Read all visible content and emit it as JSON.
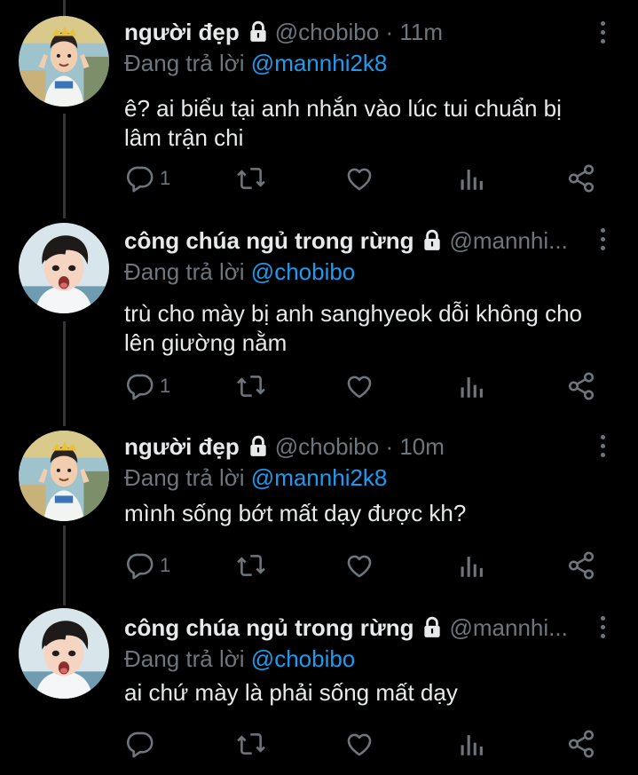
{
  "tweets": [
    {
      "name": "người đẹp",
      "handle": "@chobibo",
      "time": "11m",
      "replying_prefix": "Đang trả lời",
      "replying_to": "@mannhi2k8",
      "text": "ê? ai biểu tại anh nhắn vào lúc tui chuẩn bị lâm trận chi",
      "reply_count": "1",
      "avatar": "boy-with-crown"
    },
    {
      "name": "công chúa ngủ trong rừng",
      "handle": "@mannhi...",
      "replying_prefix": "Đang trả lời",
      "replying_to": "@chobibo",
      "text": "trù cho mày bị anh sanghyeok dỗi không cho lên giường nằm",
      "reply_count": "1",
      "avatar": "surprised-boy"
    },
    {
      "name": "người đẹp",
      "handle": "@chobibo",
      "time": "10m",
      "replying_prefix": "Đang trả lời",
      "replying_to": "@mannhi2k8",
      "text": "mình sống bớt mất dạy được kh?",
      "reply_count": "1",
      "avatar": "boy-with-crown"
    },
    {
      "name": "công chúa ngủ trong rừng",
      "handle": "@mannhi...",
      "replying_prefix": "Đang trả lời",
      "replying_to": "@chobibo",
      "text": "ai chứ mày là phải sống mất dạy",
      "reply_count": "",
      "avatar": "surprised-boy"
    }
  ],
  "colors": {
    "background": "#000000",
    "text": "#e7e9ea",
    "secondary": "#6e767d",
    "accent": "#1d9bf0",
    "thread_line": "#333639"
  },
  "icons": [
    "lock-icon",
    "more-icon",
    "reply-icon",
    "retweet-icon",
    "like-icon",
    "views-icon",
    "share-icon"
  ]
}
